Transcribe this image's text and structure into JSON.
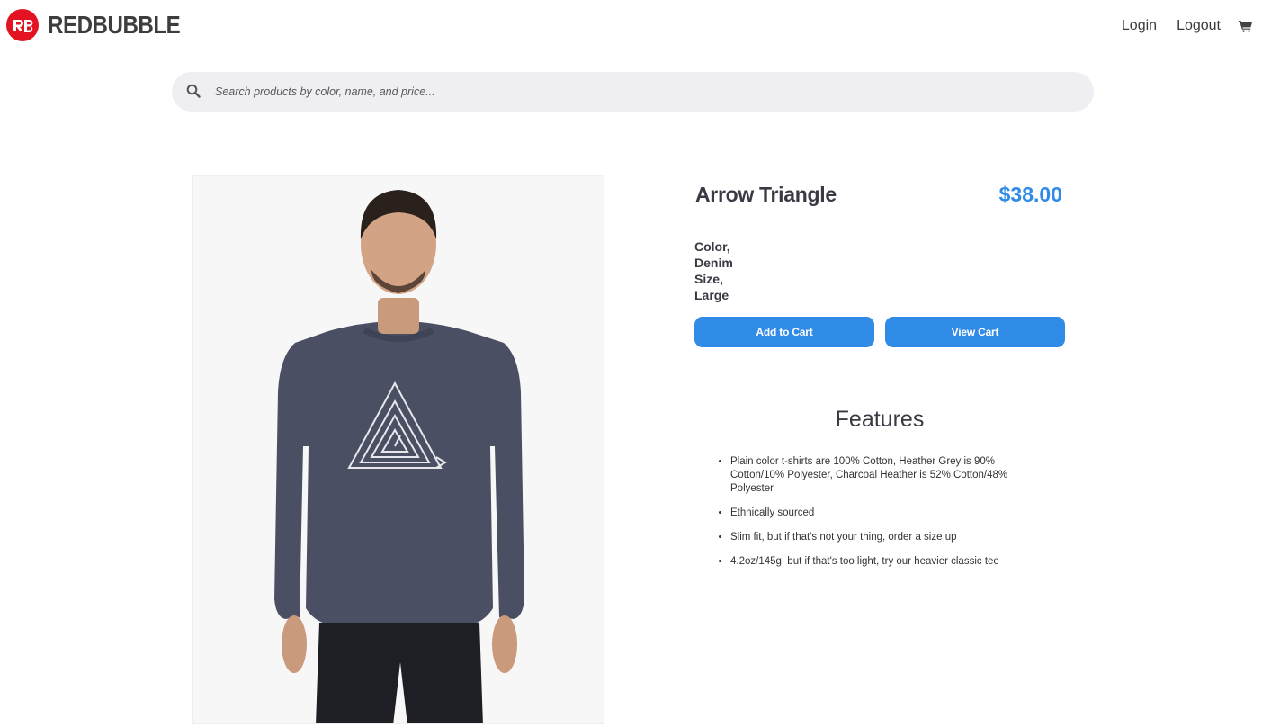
{
  "header": {
    "logo_text": "REDBUBBLE",
    "nav": {
      "login": "Login",
      "logout": "Logout"
    },
    "cart_icon": "shopping-cart-icon"
  },
  "search": {
    "placeholder": "Search products by color, name, and price...",
    "icon": "search-icon"
  },
  "product": {
    "title": "Arrow Triangle",
    "price": "$38.00",
    "options": [
      "Color,",
      "Denim",
      "Size,",
      "Large"
    ],
    "add_to_cart_label": "Add to Cart",
    "view_cart_label": "View Cart",
    "features_title": "Features",
    "features": [
      "Plain color t-shirts are 100% Cotton, Heather Grey is 90% Cotton/10% Polyester, Charcoal Heather is 52% Cotton/48% Polyester",
      "Ethnically sourced",
      "Slim fit, but if that's not your thing, order a size up",
      "4.2oz/145g, but if that's too light, try our heavier classic tee"
    ]
  },
  "colors": {
    "brand_red": "#e41321",
    "accent_blue": "#2f8be6",
    "search_bg": "#efeff3"
  }
}
